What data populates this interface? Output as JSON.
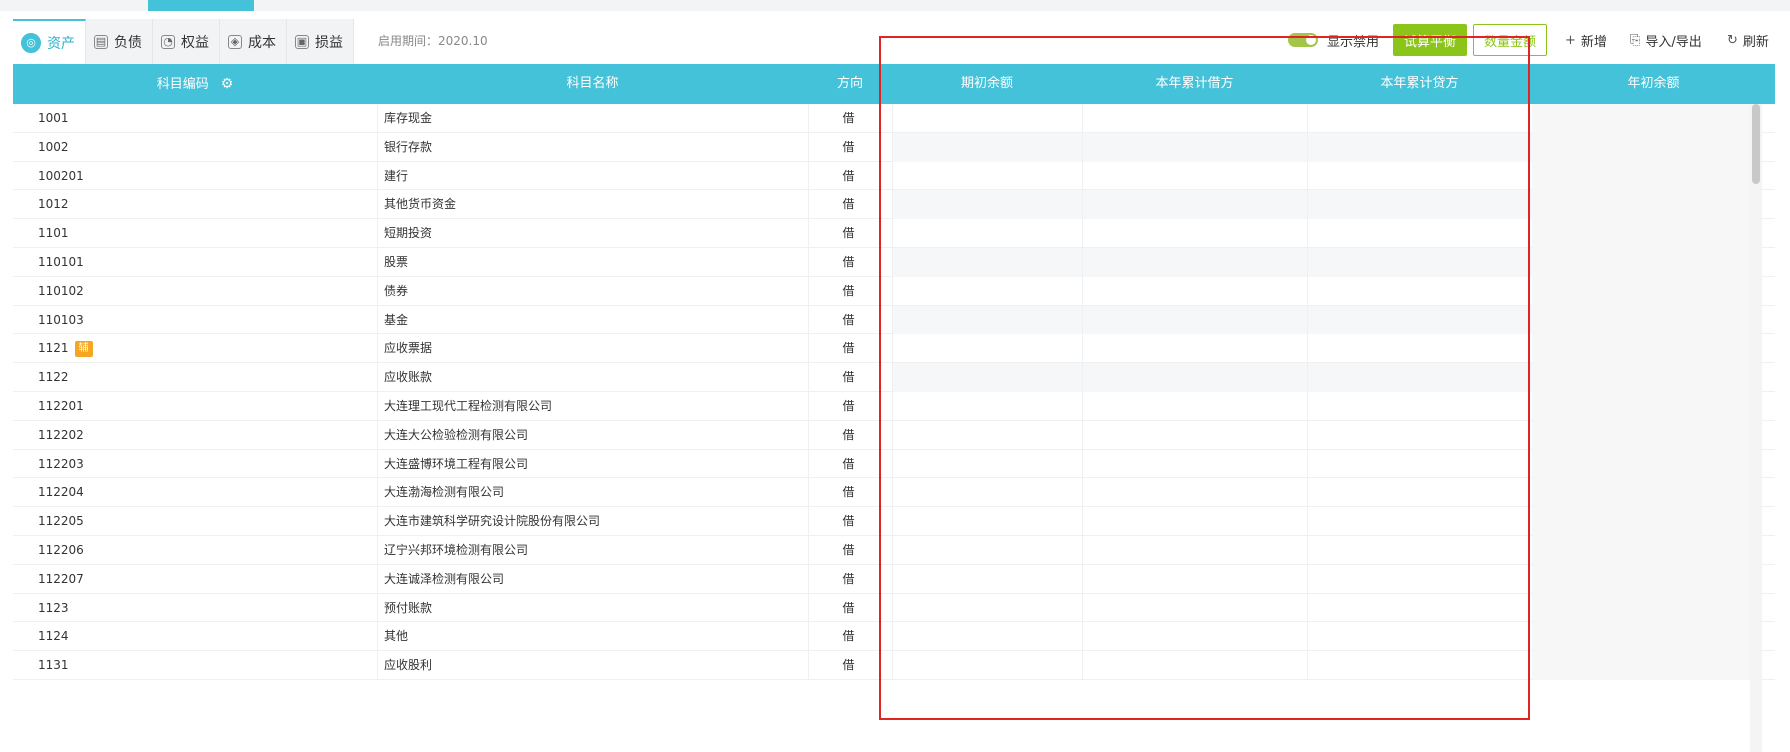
{
  "tabs": [
    {
      "label": "资产",
      "icon": "asset-icon",
      "active": true
    },
    {
      "label": "负债",
      "icon": "liability-icon",
      "active": false
    },
    {
      "label": "权益",
      "icon": "equity-icon",
      "active": false
    },
    {
      "label": "成本",
      "icon": "cost-icon",
      "active": false
    },
    {
      "label": "损益",
      "icon": "profit-loss-icon",
      "active": false
    }
  ],
  "period": "启用期间：2020.10",
  "toolbar": {
    "toggle_label": "显示禁用",
    "trial_balance": "试算平衡",
    "batch_label": "数量金额",
    "add_label": "新增",
    "io_label": "导入/导出",
    "refresh_label": "刷新"
  },
  "colors": {
    "header": "#43c2d9",
    "primary_green": "#8cc51a",
    "badge": "#f5a623",
    "highlight": "#e02424"
  },
  "columns": {
    "code": "科目编码",
    "name": "科目名称",
    "direction": "方向",
    "opening": "期初余额",
    "ytd_debit": "本年累计借方",
    "ytd_credit": "本年累计贷方",
    "year_begin": "年初余额"
  },
  "rows": [
    {
      "code": "1001",
      "name": "库存现金",
      "dir": "借",
      "badge": ""
    },
    {
      "code": "1002",
      "name": "银行存款",
      "dir": "借",
      "badge": ""
    },
    {
      "code": "100201",
      "name": "建行",
      "dir": "借",
      "badge": ""
    },
    {
      "code": "1012",
      "name": "其他货币资金",
      "dir": "借",
      "badge": ""
    },
    {
      "code": "1101",
      "name": "短期投资",
      "dir": "借",
      "badge": ""
    },
    {
      "code": "110101",
      "name": "股票",
      "dir": "借",
      "badge": ""
    },
    {
      "code": "110102",
      "name": "债券",
      "dir": "借",
      "badge": ""
    },
    {
      "code": "110103",
      "name": "基金",
      "dir": "借",
      "badge": ""
    },
    {
      "code": "1121",
      "name": "应收票据",
      "dir": "借",
      "badge": "辅"
    },
    {
      "code": "1122",
      "name": "应收账款",
      "dir": "借",
      "badge": ""
    },
    {
      "code": "112201",
      "name": "大连理工现代工程检测有限公司",
      "dir": "借",
      "badge": ""
    },
    {
      "code": "112202",
      "name": "大连大公检验检测有限公司",
      "dir": "借",
      "badge": ""
    },
    {
      "code": "112203",
      "name": "大连盛博环境工程有限公司",
      "dir": "借",
      "badge": ""
    },
    {
      "code": "112204",
      "name": "大连渤海检测有限公司",
      "dir": "借",
      "badge": ""
    },
    {
      "code": "112205",
      "name": "大连市建筑科学研究设计院股份有限公司",
      "dir": "借",
      "badge": ""
    },
    {
      "code": "112206",
      "name": "辽宁兴邦环境检测有限公司",
      "dir": "借",
      "badge": ""
    },
    {
      "code": "112207",
      "name": "大连诚泽检测有限公司",
      "dir": "借",
      "badge": ""
    },
    {
      "code": "1123",
      "name": "预付账款",
      "dir": "借",
      "badge": ""
    },
    {
      "code": "1124",
      "name": "其他",
      "dir": "借",
      "badge": ""
    },
    {
      "code": "1131",
      "name": "应收股利",
      "dir": "借",
      "badge": ""
    }
  ]
}
